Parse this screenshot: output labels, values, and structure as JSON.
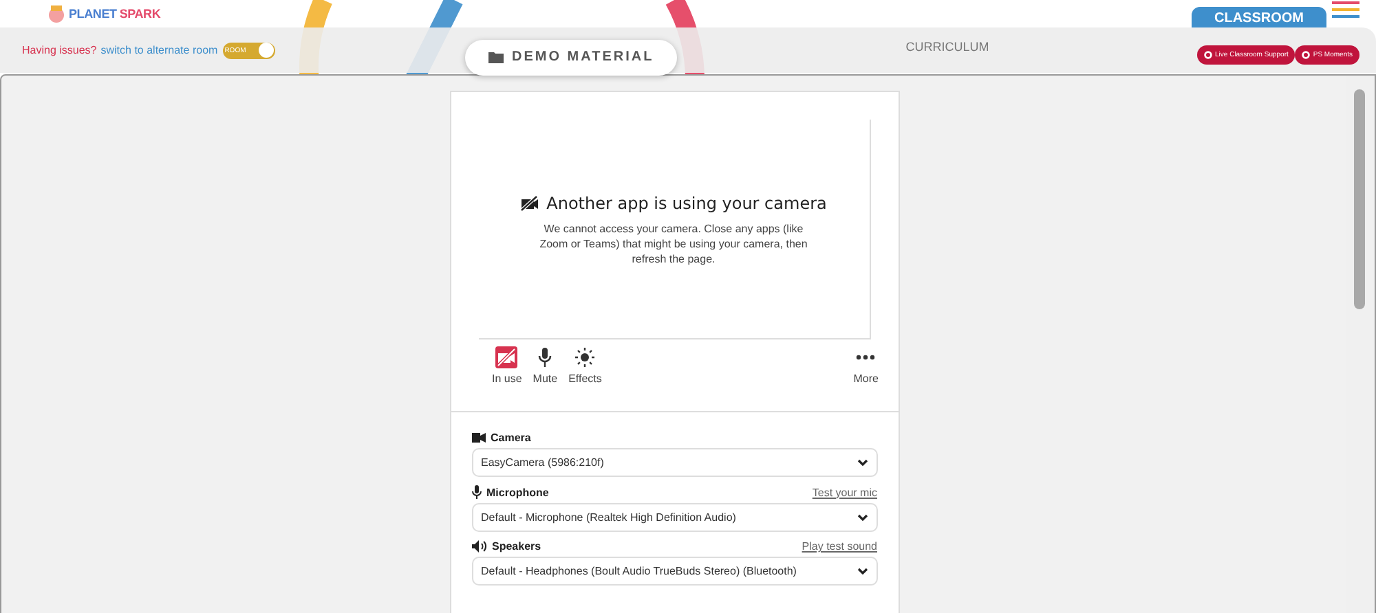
{
  "header": {
    "logo": {
      "text_1": "PLANET",
      "text_2": "SPARK"
    },
    "issue_text": "Having issues?",
    "switch_link": "switch to alternate room",
    "room_toggle": {
      "label": "ROOM",
      "on": true
    },
    "demo_button": "DEMO MATERIAL",
    "curriculum_tab": "CURRICULUM",
    "classroom_tab": "CLASSROOM",
    "support_buttons": [
      "Live Classroom Support",
      "PS Moments"
    ]
  },
  "preview": {
    "title": "Another app is using your camera",
    "message": "We cannot access your camera. Close any apps (like Zoom or Teams) that might be using your camera, then refresh the page.",
    "controls": [
      {
        "kind": "camera",
        "label": "In use",
        "alert": true
      },
      {
        "kind": "mic",
        "label": "Mute",
        "alert": false
      },
      {
        "kind": "effects",
        "label": "Effects",
        "alert": false
      },
      {
        "kind": "more",
        "label": "More",
        "alert": false
      }
    ]
  },
  "devices": [
    {
      "kind": "camera",
      "label": "Camera",
      "value": "EasyCamera (5986:210f)"
    },
    {
      "kind": "mic",
      "label": "Microphone",
      "link": "Test your mic",
      "value": "Default - Microphone (Realtek High Definition Audio)"
    },
    {
      "kind": "speaker",
      "label": "Speakers",
      "link": "Play test sound",
      "value": "Default - Headphones (Boult Audio TrueBuds Stereo) (Bluetooth)"
    }
  ]
}
